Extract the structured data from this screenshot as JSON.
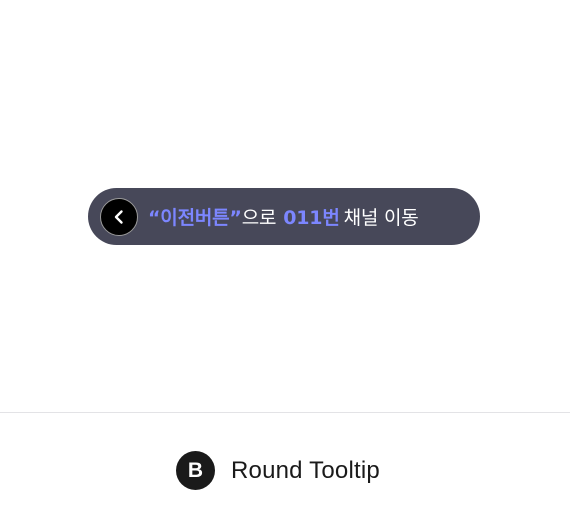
{
  "tooltip": {
    "quote_segment": "“이전버튼”",
    "particle": "으로",
    "channel_segment": "011번",
    "action_text": "채널 이동",
    "back_icon": "chevron-left-icon"
  },
  "caption": {
    "badge_letter": "B",
    "label": "Round Tooltip"
  },
  "colors": {
    "tooltip_background": "#474859",
    "accent": "#7c86ff",
    "text_primary": "#ffffff",
    "badge_background": "#1a1a1a",
    "divider": "#e3e3e6"
  }
}
